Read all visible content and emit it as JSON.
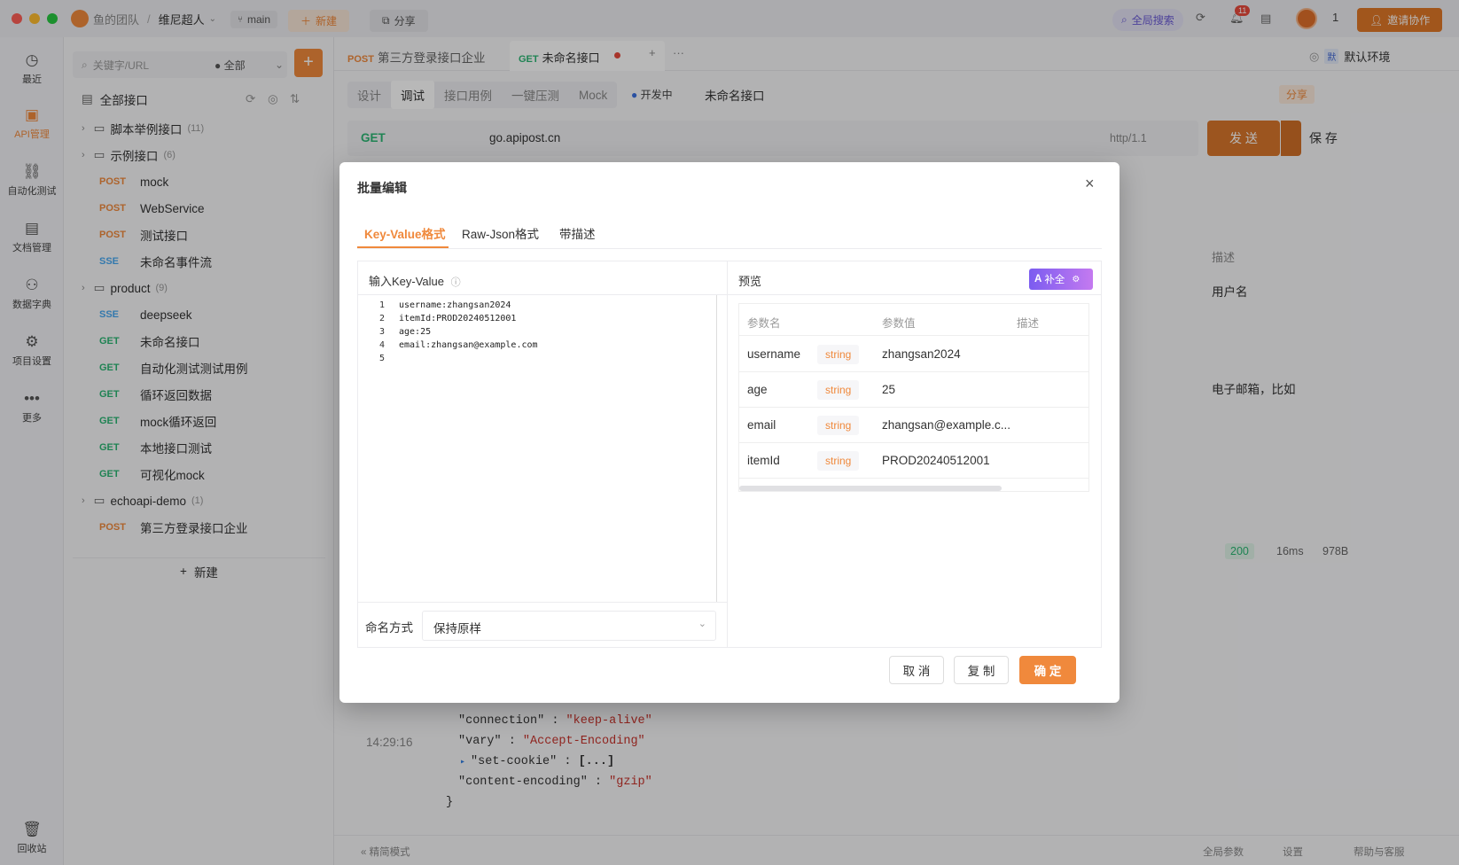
{
  "titlebar": {
    "team": "鱼的团队",
    "separator": "/",
    "project": "维尼超人",
    "branch": "main",
    "new_label": "新建",
    "share_label": "分享",
    "global_search": "全局搜索",
    "notify_count": "11",
    "user_count": "1",
    "invite_label": "邀请协作"
  },
  "rail": {
    "items": [
      {
        "label": "最近",
        "icon": "clock-icon"
      },
      {
        "label": "API管理",
        "icon": "api-icon"
      },
      {
        "label": "自动化测试",
        "icon": "flow-icon"
      },
      {
        "label": "文档管理",
        "icon": "doc-icon"
      },
      {
        "label": "数据字典",
        "icon": "dict-icon"
      },
      {
        "label": "项目设置",
        "icon": "settings-icon"
      },
      {
        "label": "更多",
        "icon": "more-icon"
      }
    ],
    "trash": "回收站"
  },
  "sidebar": {
    "search_placeholder": "关键字/URL",
    "filter": "全部",
    "all_label": "全部接口",
    "tree": [
      {
        "type": "folder",
        "name": "脚本举例接口",
        "count": "(11)"
      },
      {
        "type": "folder",
        "name": "示例接口",
        "count": "(6)"
      },
      {
        "type": "api",
        "method": "POST",
        "name": "mock"
      },
      {
        "type": "api",
        "method": "POST",
        "name": "WebService"
      },
      {
        "type": "api",
        "method": "POST",
        "name": "测试接口"
      },
      {
        "type": "api",
        "method": "SSE",
        "name": "未命名事件流"
      },
      {
        "type": "folder",
        "name": "product",
        "count": "(9)"
      },
      {
        "type": "api",
        "method": "SSE",
        "name": "deepseek"
      },
      {
        "type": "api",
        "method": "GET",
        "name": "未命名接口"
      },
      {
        "type": "api",
        "method": "GET",
        "name": "自动化测试测试用例"
      },
      {
        "type": "api",
        "method": "GET",
        "name": "循环返回数据"
      },
      {
        "type": "api",
        "method": "GET",
        "name": "mock循环返回"
      },
      {
        "type": "api",
        "method": "GET",
        "name": "本地接口测试"
      },
      {
        "type": "api",
        "method": "GET",
        "name": "可视化mock"
      },
      {
        "type": "folder",
        "name": "echoapi-demo",
        "count": "(1)"
      },
      {
        "type": "api",
        "method": "POST",
        "name": "第三方登录接口企业"
      }
    ],
    "new_label": "新建"
  },
  "main": {
    "tabs": [
      {
        "method": "POST",
        "name": "第三方登录接口企业"
      },
      {
        "method": "GET",
        "name": "未命名接口"
      }
    ],
    "env": "默认环境",
    "env_badge": "默",
    "subtabs": [
      "设计",
      "调试",
      "接口用例",
      "一键压测",
      "Mock"
    ],
    "status": "开发中",
    "api_name": "未命名接口",
    "share": "分享",
    "method": "GET",
    "url": "go.apipost.cn",
    "protocol": "http/1.1",
    "send": "发 送",
    "save": "保 存",
    "desc_header": "描述",
    "desc_values": [
      "用户名",
      "电子邮箱，比如"
    ],
    "resp_code": "200",
    "resp_time": "16ms",
    "resp_size": "978B",
    "timestamp": "14:29:16",
    "json_lines": [
      {
        "k": "\"connection\"",
        "v": "\"keep-alive\""
      },
      {
        "k": "\"vary\"",
        "v": "\"Accept-Encoding\""
      },
      {
        "k": "\"set-cookie\"",
        "v": "[...]"
      },
      {
        "k": "\"content-encoding\"",
        "v": "\"gzip\""
      }
    ],
    "json_close": "}",
    "footer_left": "精简模式",
    "footer_items": [
      "全局参数",
      "设置",
      "帮助与客服"
    ]
  },
  "modal": {
    "title": "批量编辑",
    "tabs": [
      "Key-Value格式",
      "Raw-Json格式",
      "带描述"
    ],
    "input_label": "输入Key-Value",
    "code_lines": [
      {
        "n": "1",
        "t": "username:zhangsan2024"
      },
      {
        "n": "2",
        "t": "itemId:PROD20240512001"
      },
      {
        "n": "3",
        "t": "age:25"
      },
      {
        "n": "4",
        "t": "email:zhangsan@example.com"
      },
      {
        "n": "5",
        "t": ""
      }
    ],
    "naming_label": "命名方式",
    "naming_value": "保持原样",
    "preview_label": "预览",
    "complete_label": "补全",
    "table_headers": [
      "参数名",
      "参数值",
      "描述"
    ],
    "rows": [
      {
        "name": "username",
        "type": "string",
        "value": "zhangsan2024"
      },
      {
        "name": "age",
        "type": "string",
        "value": "25"
      },
      {
        "name": "email",
        "type": "string",
        "value": "zhangsan@example.c..."
      },
      {
        "name": "itemId",
        "type": "string",
        "value": "PROD20240512001"
      }
    ],
    "cancel": "取 消",
    "copy": "复 制",
    "ok": "确 定"
  },
  "colors": {
    "accent": "#f0893c",
    "get": "#2bb673",
    "post": "#f0893c",
    "sse": "#48a8f0"
  }
}
